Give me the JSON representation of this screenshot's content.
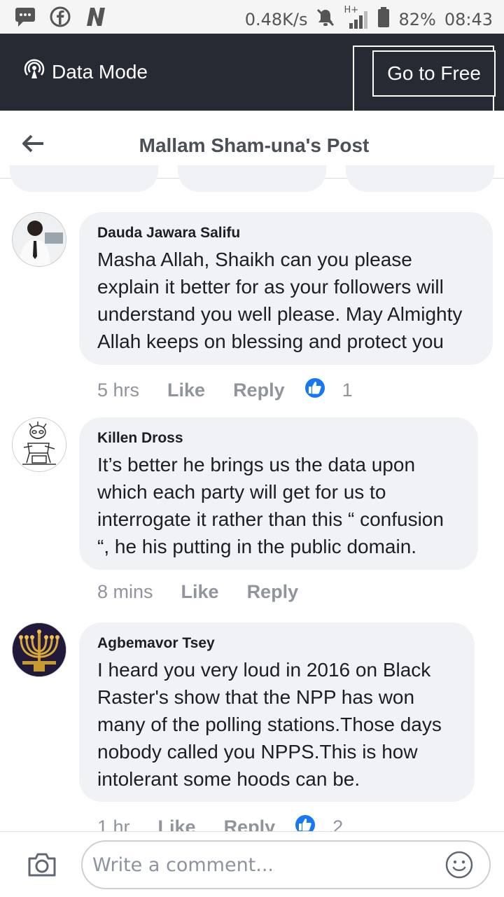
{
  "status_bar": {
    "network_speed": "0.48K/s",
    "network_type": "H+",
    "battery": "82%",
    "time": "08:43",
    "left_icons": [
      "message-icon",
      "facebook-icon",
      "n-app-icon"
    ]
  },
  "top_bar": {
    "data_mode_label": "Data Mode",
    "go_free_label": "Go to Free"
  },
  "header": {
    "title": "Mallam Sham-una's Post"
  },
  "comments": [
    {
      "author": "Dauda Jawara Salifu",
      "text": "Masha Allah, Shaikh can you please explain it better for as your followers will understand you well please. May Almighty Allah keeps on blessing and protect you",
      "time": "5 hrs",
      "like_label": "Like",
      "reply_label": "Reply",
      "reaction_count": "1"
    },
    {
      "author": "Killen Dross",
      "text": "It’s better he brings us the data upon which each party will get for us to interrogate it rather than this “ confusion “, he his putting in the public domain.",
      "time": "8 mins",
      "like_label": "Like",
      "reply_label": "Reply",
      "reaction_count": ""
    },
    {
      "author": "Agbemavor Tsey",
      "text": "I heard you very loud in 2016 on Black Raster's show that the NPP has won many of the polling stations.Those days nobody called you NPPS.This is how intolerant some hoods can be.",
      "time": "1 hr",
      "like_label": "Like",
      "reply_label": "Reply",
      "reaction_count": "2"
    }
  ],
  "composer": {
    "placeholder": "Write a comment..."
  },
  "colors": {
    "top_bar_bg": "#252a33",
    "bubble_bg": "#f0f2f5",
    "like_blue": "#1877f2",
    "action_gray": "#90949c"
  }
}
